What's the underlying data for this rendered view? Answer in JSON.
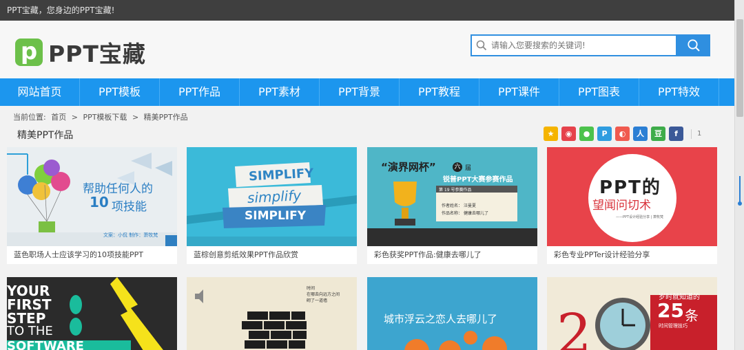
{
  "topbar": {
    "text": "PPT宝藏，您身边的PPT宝藏!"
  },
  "logo": {
    "mark": "p",
    "text": "PPT宝藏"
  },
  "search": {
    "placeholder": "请输入您要搜索的关键词!"
  },
  "nav": {
    "items": [
      "网站首页",
      "PPT模板",
      "PPT作品",
      "PPT素材",
      "PPT背景",
      "PPT教程",
      "PPT课件",
      "PPT图表",
      "PPT特效"
    ]
  },
  "breadcrumb": {
    "label": "当前位置:",
    "home": "首页",
    "sep1": ">",
    "level1": "PPT模板下载",
    "sep2": ">",
    "current": "精美PPT作品"
  },
  "section": {
    "title": "精美PPT作品"
  },
  "share": {
    "count": "1",
    "icons": [
      "qzone-icon",
      "weibo-icon",
      "wechat-icon",
      "pinterest-icon",
      "qq-icon",
      "renren-icon",
      "douban-icon",
      "facebook-icon"
    ]
  },
  "cards": [
    {
      "caption": "蓝色职场人士应该学习的10项技能PPT",
      "thumb_title": "帮助任何人的",
      "thumb_title2": "项技能",
      "thumb_num": "10",
      "thumb_credit": "文案：小侃    制作：萧牧梵"
    },
    {
      "caption": "蓝棕创意剪纸效果PPT作品欣赏",
      "thumb_word": "SIMPLIFY",
      "thumb_word2": "simplify",
      "thumb_word3": "SIMPLIFY"
    },
    {
      "caption": "彩色获奖PPT作品:健康去哪儿了",
      "thumb_title": "“演界网杯”",
      "thumb_badge": "六",
      "thumb_sub": "届",
      "thumb_line2": "锐普PPT大赛参赛作品",
      "thumb_no": "第 19 号参赛作品",
      "thumb_author": "作者姓名：",
      "thumb_author_val": "汪曼夏",
      "thumb_work": "作品名称：",
      "thumb_work_val": "健康去哪儿了"
    },
    {
      "caption": "彩色专业PPTer设计经验分享",
      "thumb_title": "PPT的",
      "thumb_title2": "望闻问切术",
      "thumb_sub": "——PPT设计经验分享 | 萧牧梵"
    }
  ],
  "cards_row2": [
    {
      "lines": [
        "YOUR",
        "FIRST",
        "STEP",
        "TO THE",
        "SOFTWARE"
      ]
    },
    {
      "text": "时间\n在哪去向远方之间\n砌了一道墙"
    },
    {
      "text": "城市浮云之恋人去哪儿了"
    },
    {
      "title": "岁时就知道的",
      "num": "25",
      "unit": "条",
      "sub": "时间管理技巧"
    }
  ],
  "colors": {
    "nav": "#1c96ee",
    "topbar": "#3f3f3f",
    "logo": "#6cc04a",
    "search": "#2f8fe0"
  }
}
